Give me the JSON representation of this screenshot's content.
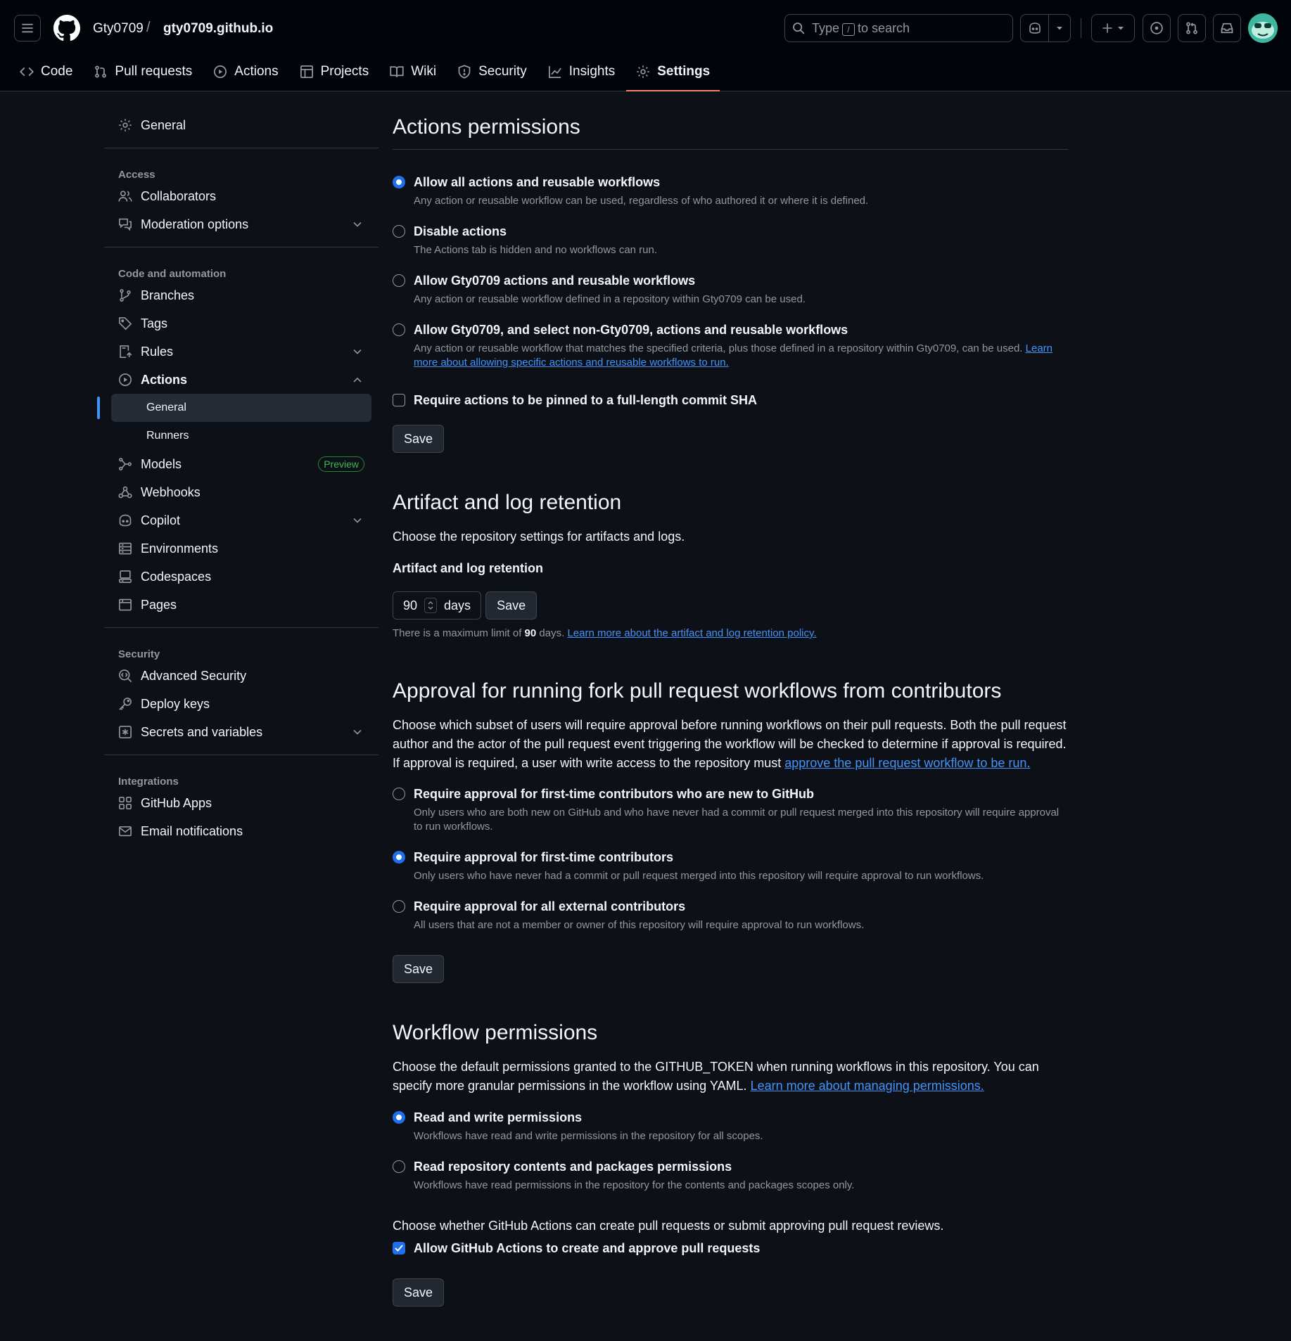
{
  "header": {
    "owner": "Gty0709",
    "separator": "/",
    "repo": "gty0709.github.io",
    "search": {
      "prefix": "Type",
      "key": "/",
      "suffix": "to search"
    }
  },
  "tabs": [
    {
      "label": "Code",
      "icon": "code-icon"
    },
    {
      "label": "Pull requests",
      "icon": "git-pull-request-icon"
    },
    {
      "label": "Actions",
      "icon": "play-icon"
    },
    {
      "label": "Projects",
      "icon": "table-icon"
    },
    {
      "label": "Wiki",
      "icon": "book-icon"
    },
    {
      "label": "Security",
      "icon": "shield-icon"
    },
    {
      "label": "Insights",
      "icon": "graph-icon"
    },
    {
      "label": "Settings",
      "icon": "gear-icon",
      "active": true
    }
  ],
  "sidebar": {
    "general": "General",
    "groups": {
      "access": "Access",
      "code_automation": "Code and automation",
      "security": "Security",
      "integrations": "Integrations"
    },
    "items": {
      "collaborators": "Collaborators",
      "moderation": "Moderation options",
      "branches": "Branches",
      "tags": "Tags",
      "rules": "Rules",
      "actions": "Actions",
      "actions_general": "General",
      "actions_runners": "Runners",
      "models": "Models",
      "models_badge": "Preview",
      "webhooks": "Webhooks",
      "copilot": "Copilot",
      "environments": "Environments",
      "codespaces": "Codespaces",
      "pages": "Pages",
      "advanced_security": "Advanced Security",
      "deploy_keys": "Deploy keys",
      "secrets": "Secrets and variables",
      "github_apps": "GitHub Apps",
      "email_notifications": "Email notifications"
    }
  },
  "actions_permissions": {
    "title": "Actions permissions",
    "options": [
      {
        "title": "Allow all actions and reusable workflows",
        "desc": "Any action or reusable workflow can be used, regardless of who authored it or where it is defined.",
        "checked": true
      },
      {
        "title": "Disable actions",
        "desc": "The Actions tab is hidden and no workflows can run.",
        "checked": false
      },
      {
        "title": "Allow Gty0709 actions and reusable workflows",
        "desc": "Any action or reusable workflow defined in a repository within Gty0709 can be used.",
        "checked": false
      },
      {
        "title": "Allow Gty0709, and select non-Gty0709, actions and reusable workflows",
        "desc": "Any action or reusable workflow that matches the specified criteria, plus those defined in a repository within Gty0709, can be used.",
        "link": "Learn more about allowing specific actions and reusable workflows to run.",
        "checked": false
      }
    ],
    "pin_sha": "Require actions to be pinned to a full-length commit SHA",
    "save": "Save"
  },
  "retention": {
    "title": "Artifact and log retention",
    "desc": "Choose the repository settings for artifacts and logs.",
    "label": "Artifact and log retention",
    "value": "90",
    "unit": "days",
    "save": "Save",
    "note_prefix": "There is a maximum limit of",
    "note_max": "90",
    "note_suffix": "days.",
    "note_link": "Learn more about the artifact and log retention policy."
  },
  "approval": {
    "title": "Approval for running fork pull request workflows from contributors",
    "desc": "Choose which subset of users will require approval before running workflows on their pull requests. Both the pull request author and the actor of the pull request event triggering the workflow will be checked to determine if approval is required. If approval is required, a user with write access to the repository must",
    "link": "approve the pull request workflow to be run.",
    "options": [
      {
        "title": "Require approval for first-time contributors who are new to GitHub",
        "desc": "Only users who are both new on GitHub and who have never had a commit or pull request merged into this repository will require approval to run workflows.",
        "checked": false
      },
      {
        "title": "Require approval for first-time contributors",
        "desc": "Only users who have never had a commit or pull request merged into this repository will require approval to run workflows.",
        "checked": true
      },
      {
        "title": "Require approval for all external contributors",
        "desc": "All users that are not a member or owner of this repository will require approval to run workflows.",
        "checked": false
      }
    ],
    "save": "Save"
  },
  "workflow": {
    "title": "Workflow permissions",
    "desc": "Choose the default permissions granted to the GITHUB_TOKEN when running workflows in this repository. You can specify more granular permissions in the workflow using YAML.",
    "link": "Learn more about managing permissions.",
    "options": [
      {
        "title": "Read and write permissions",
        "desc": "Workflows have read and write permissions in the repository for all scopes.",
        "checked": true
      },
      {
        "title": "Read repository contents and packages permissions",
        "desc": "Workflows have read permissions in the repository for the contents and packages scopes only.",
        "checked": false
      }
    ],
    "pr_desc": "Choose whether GitHub Actions can create pull requests or submit approving pull request reviews.",
    "pr_option": "Allow GitHub Actions to create and approve pull requests",
    "pr_checked": true,
    "save": "Save"
  }
}
